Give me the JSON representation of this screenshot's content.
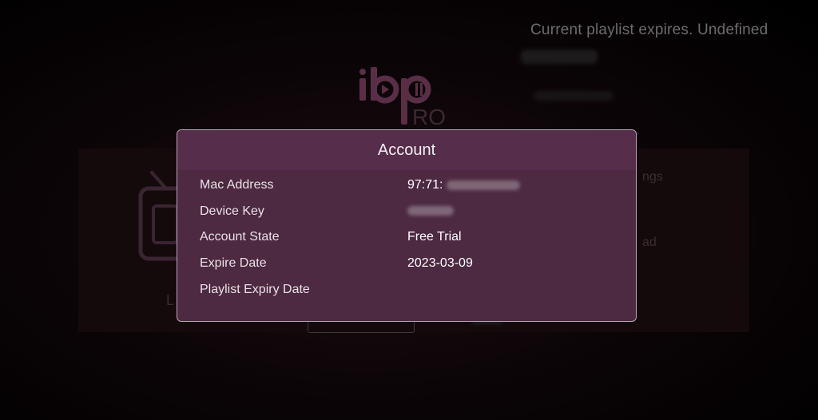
{
  "background": {
    "expiry_notice": "Current playlist expires. Undefined",
    "logo": {
      "top": "ibp",
      "bottom": "RO"
    },
    "settings_label": "ngs",
    "download_label": "ad",
    "tv_label": "L"
  },
  "dialog": {
    "title": "Account",
    "rows": [
      {
        "label": "Mac Address",
        "value": "97:71:"
      },
      {
        "label": "Device Key",
        "value": ""
      },
      {
        "label": "Account State",
        "value": "Free Trial"
      },
      {
        "label": "Expire Date",
        "value": "2023-03-09"
      },
      {
        "label": "Playlist Expiry Date",
        "value": ""
      }
    ]
  },
  "colors": {
    "dialog_bg": "#4d2942",
    "dialog_header": "#562d4b",
    "dialog_border": "#b9a9b6",
    "logo_accent": "#5a2e47"
  },
  "icons": {
    "logo": "ibo-pro-logo-icon",
    "tv": "tv-icon"
  }
}
